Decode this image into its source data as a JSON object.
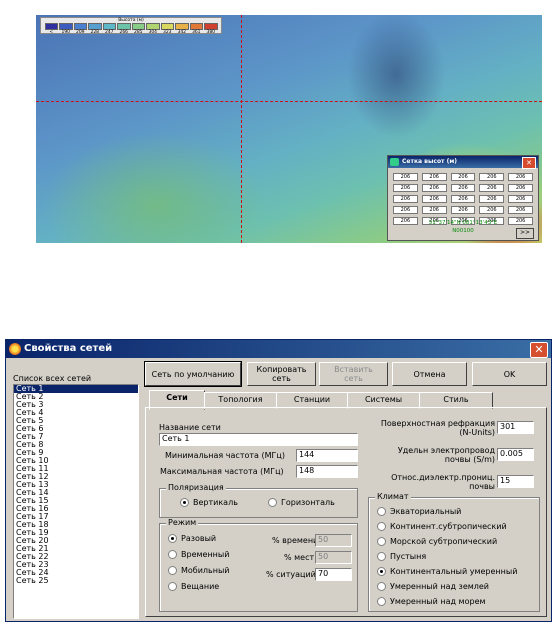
{
  "map": {
    "legend_title": "Высота (м)",
    "legend_values": [
      "<",
      "190",
      "209",
      "228",
      "247",
      "266",
      "285",
      "304",
      "323",
      "342",
      "361",
      "380"
    ],
    "legend_colors": [
      "#3030a0",
      "#3c5cc0",
      "#4a80d0",
      "#56a0d0",
      "#5fb8c8",
      "#6cc4a8",
      "#88cc88",
      "#b0d470",
      "#d8d860",
      "#e8b048",
      "#e07838",
      "#d04030"
    ]
  },
  "grid_popup": {
    "title": "Сетка высот (м)",
    "close": "✕",
    "cells": [
      "206",
      "206",
      "206",
      "206",
      "206",
      "206",
      "206",
      "206",
      "206",
      "206",
      "206",
      "206",
      "206",
      "206",
      "206",
      "206",
      "206",
      "206",
      "206",
      "206",
      "206",
      "206",
      "206",
      "206",
      "206"
    ],
    "coords": "51°37'14\"N  081°13'43\"E",
    "id": "N00100",
    "nav": ">>"
  },
  "dialog": {
    "title": "Свойства сетей",
    "close": "✕",
    "list_label": "Список всех сетей",
    "networks": [
      "Сеть  1",
      "Сеть  2",
      "Сеть  3",
      "Сеть  4",
      "Сеть  5",
      "Сеть  6",
      "Сеть  7",
      "Сеть  8",
      "Сеть  9",
      "Сеть 10",
      "Сеть 11",
      "Сеть 12",
      "Сеть 13",
      "Сеть 14",
      "Сеть 15",
      "Сеть 16",
      "Сеть 17",
      "Сеть 18",
      "Сеть 19",
      "Сеть 20",
      "Сеть 21",
      "Сеть 22",
      "Сеть 23",
      "Сеть 24",
      "Сеть 25"
    ],
    "buttons": {
      "default": "Сеть по умолчанию",
      "copy_1": "Копировать",
      "copy_2": "сеть",
      "paste_1": "Вставить",
      "paste_2": "сеть",
      "cancel": "Отмена",
      "ok": "OK"
    },
    "tabs": [
      "Сети",
      "Топология",
      "Станции",
      "Системы",
      "Стиль"
    ],
    "form": {
      "name_label": "Название сети",
      "name_value": "Сеть  1",
      "min_freq_label": "Минимальная частота (МГц)",
      "min_freq_value": "144",
      "max_freq_label": "Максимальная частота (МГц)",
      "max_freq_value": "148",
      "refraction_label_1": "Поверхностная рефракция",
      "refraction_label_2": "(N-Units)",
      "refraction_value": "301",
      "conductivity_label_1": "Удельн электропровод",
      "conductivity_label_2": "почвы (S/m)",
      "conductivity_value": "0.005",
      "permittivity_label_1": "Относ.диэлектр.прониц.",
      "permittivity_label_2": "почвы",
      "permittivity_value": "15"
    },
    "polarization": {
      "title": "Поляризация",
      "options": [
        "Вертикаль",
        "Горизонталь"
      ],
      "selected": 0
    },
    "mode": {
      "title": "Режим",
      "options": [
        "Разовый",
        "Временный",
        "Мобильный",
        "Вещание"
      ],
      "selected": 0,
      "time_label": "% времени",
      "time_value": "50",
      "places_label": "% мест",
      "places_value": "50",
      "situations_label": "% ситуаций",
      "situations_value": "70"
    },
    "climate": {
      "title": "Климат",
      "options": [
        "Экваториальный",
        "Континент.субтропический",
        "Морской субтропический",
        "Пустыня",
        "Континентальный умеренный",
        "Умеренный над землей",
        "Умеренный над морем"
      ],
      "selected": 4
    }
  }
}
